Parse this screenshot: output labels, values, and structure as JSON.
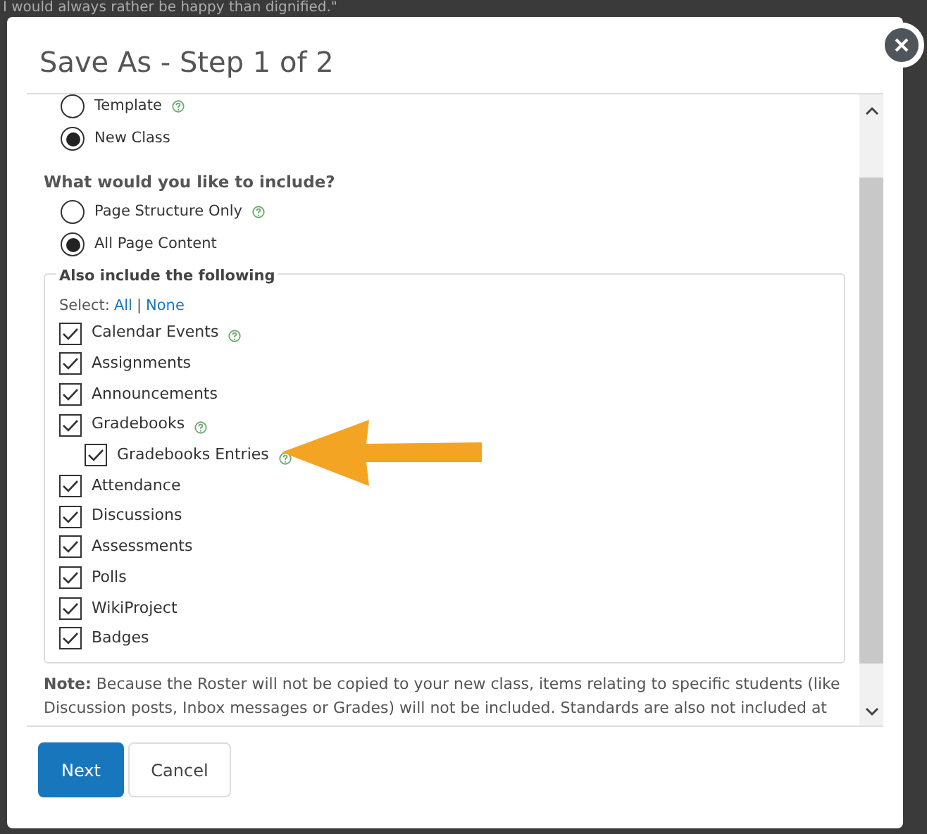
{
  "background_text": "I would always rather be happy than dignified.\"",
  "dialog": {
    "title": "Save As - Step 1 of 2"
  },
  "save_type": {
    "options": [
      {
        "label": "Template",
        "selected": false,
        "help": true
      },
      {
        "label": "New Class",
        "selected": true,
        "help": false
      }
    ]
  },
  "include": {
    "question": "What would you like to include?",
    "options": [
      {
        "label": "Page Structure Only",
        "selected": false,
        "help": true
      },
      {
        "label": "All Page Content",
        "selected": true,
        "help": false
      }
    ]
  },
  "also_include": {
    "legend": "Also include the following",
    "select_label": "Select:",
    "select_all": "All",
    "separator": "|",
    "select_none": "None",
    "items": [
      {
        "label": "Calendar Events",
        "checked": true,
        "help": true
      },
      {
        "label": "Assignments",
        "checked": true,
        "help": false
      },
      {
        "label": "Announcements",
        "checked": true,
        "help": false
      },
      {
        "label": "Gradebooks",
        "checked": true,
        "help": true,
        "children": [
          {
            "label": "Gradebooks Entries",
            "checked": true,
            "help": true
          }
        ]
      },
      {
        "label": "Attendance",
        "checked": true,
        "help": false
      },
      {
        "label": "Discussions",
        "checked": true,
        "help": false
      },
      {
        "label": "Assessments",
        "checked": true,
        "help": false
      },
      {
        "label": "Polls",
        "checked": true,
        "help": false
      },
      {
        "label": "WikiProject",
        "checked": true,
        "help": false
      },
      {
        "label": "Badges",
        "checked": true,
        "help": false
      }
    ]
  },
  "note": "**Note:** Because the Roster will not be copied to your new class, items relating to specific students (like Discussion posts, Inbox messages or Grades) will not be included. Standards are also not included at",
  "buttons": [
    {
      "label": "Next",
      "kind": "primary"
    },
    {
      "label": "Cancel",
      "kind": "secondary"
    }
  ]
}
